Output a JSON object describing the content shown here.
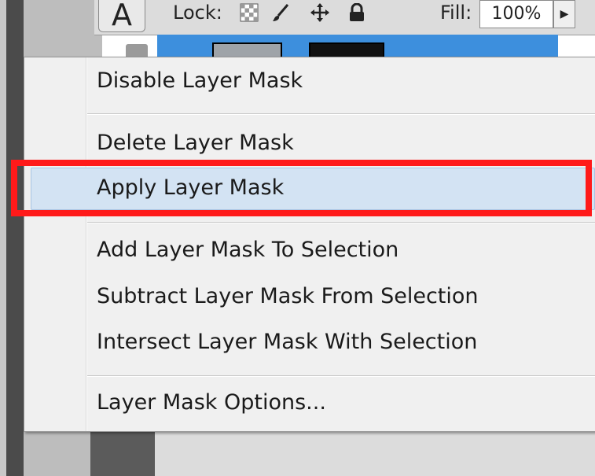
{
  "toolbar": {
    "lock_label": "Lock:",
    "fill_label": "Fill:",
    "fill_value": "100%",
    "tool_glyph": "A"
  },
  "context_menu": {
    "items": [
      {
        "label": "Disable Layer Mask"
      },
      {
        "label": "Delete Layer Mask"
      },
      {
        "label": "Apply Layer Mask",
        "highlighted": true
      },
      {
        "label": "Add Layer Mask To Selection"
      },
      {
        "label": "Subtract Layer Mask From Selection"
      },
      {
        "label": "Intersect Layer Mask With Selection"
      },
      {
        "label": "Layer Mask Options..."
      }
    ]
  },
  "icons": {
    "lock_transparent": "checkerboard-icon",
    "lock_image": "brush-icon",
    "lock_position": "move-icon",
    "lock_all": "padlock-icon",
    "fill_dropdown": "triangle-right-icon"
  },
  "colors": {
    "annotation_red": "#ff1a1a",
    "hover_blue": "#d3e3f3",
    "layer_selected": "#3d8fdd"
  }
}
